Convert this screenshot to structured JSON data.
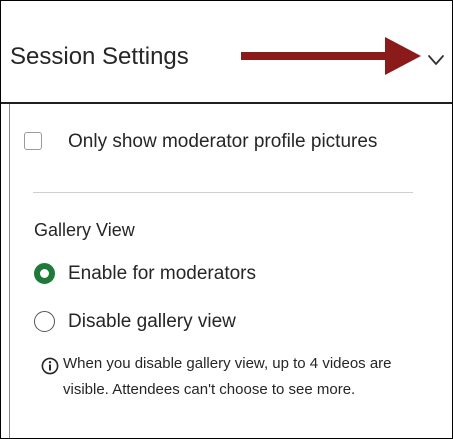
{
  "header": {
    "title": "Session Settings",
    "chevron_icon": "chevron-down-icon",
    "annotation_arrow_color": "#8b1a1a"
  },
  "options": {
    "profile_pictures": {
      "label": "Only show moderator profile pictures",
      "checked": false
    }
  },
  "gallery_view": {
    "title": "Gallery View",
    "choices": [
      {
        "label": "Enable for moderators",
        "selected": true
      },
      {
        "label": "Disable gallery view",
        "selected": false
      }
    ],
    "info_icon": "info-icon",
    "info_text": "When you disable gallery view, up to 4 videos are visible. Attendees can't choose to see more."
  },
  "colors": {
    "accent_green": "#1f7a3a",
    "text": "#262626"
  }
}
